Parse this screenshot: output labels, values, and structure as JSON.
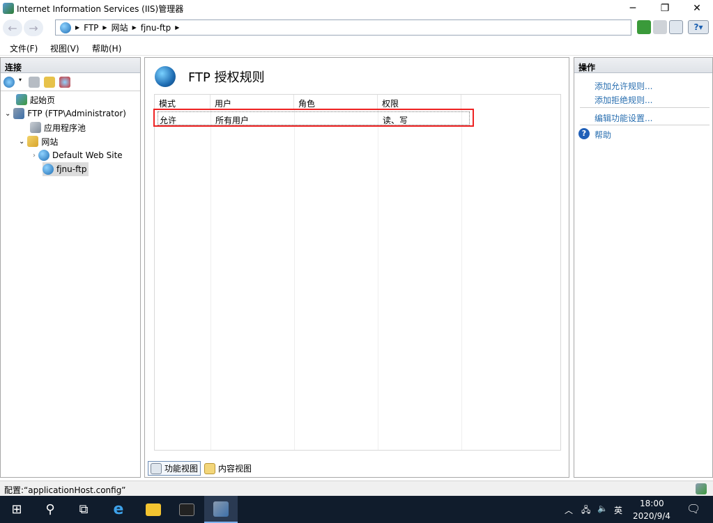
{
  "window": {
    "title": "Internet Information Services (IIS)管理器",
    "minimize": "─",
    "maximize": "❐",
    "close": "✕"
  },
  "address": {
    "crumbs": [
      "FTP",
      "网站",
      "fjnu-ftp"
    ]
  },
  "menu": [
    "文件(F)",
    "视图(V)",
    "帮助(H)"
  ],
  "connections": {
    "title": "连接",
    "tree": [
      {
        "label": "起始页"
      },
      {
        "label": "FTP (FTP\\Administrator)"
      },
      {
        "label": "应用程序池"
      },
      {
        "label": "网站"
      },
      {
        "label": "Default Web Site"
      },
      {
        "label": "fjnu-ftp"
      }
    ]
  },
  "main": {
    "title": "FTP 授权规则",
    "columns": [
      "模式",
      "用户",
      "角色",
      "权限"
    ],
    "rows": [
      {
        "mode": "允许",
        "user": "所有用户",
        "role": "",
        "perm": "读、写"
      }
    ],
    "tabs": [
      "功能视图",
      "内容视图"
    ]
  },
  "actions": {
    "title": "操作",
    "items": [
      "添加允许规则...",
      "添加拒绝规则...",
      "编辑功能设置...",
      "帮助"
    ]
  },
  "status": {
    "text": "配置:“applicationHost.config”"
  },
  "taskbar": {
    "time": "18:00",
    "date": "2020/9/4",
    "ime": "英",
    "accent": "#101c2c"
  }
}
